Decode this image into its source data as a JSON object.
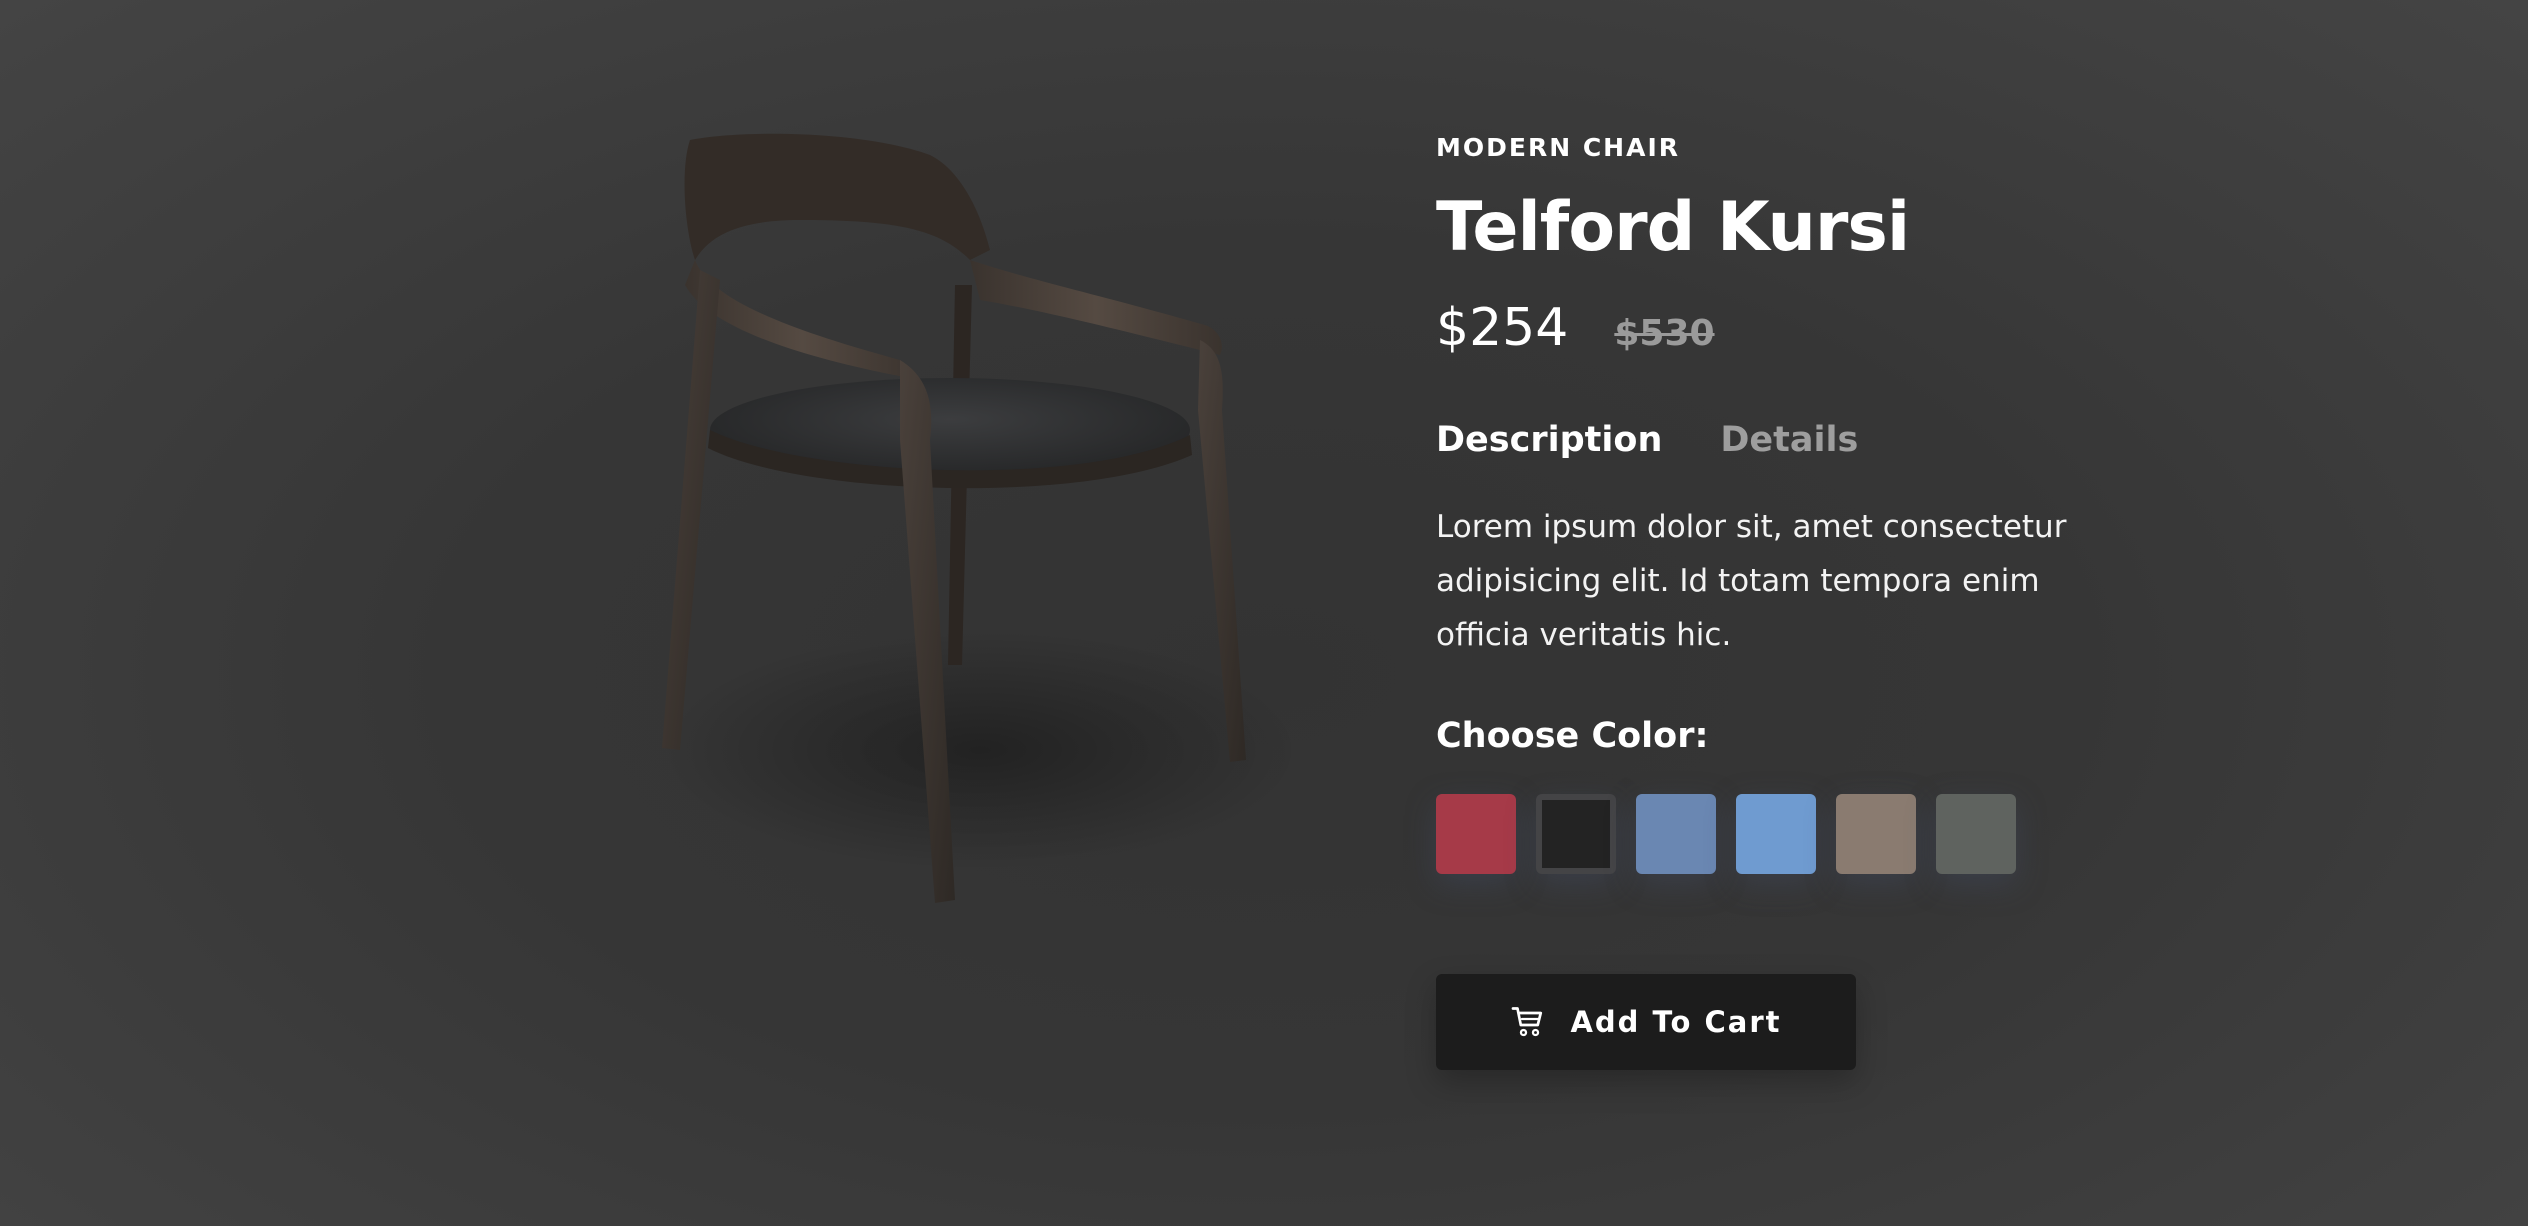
{
  "product": {
    "category": "MODERN CHAIR",
    "name": "Telford Kursi",
    "price": "$254",
    "old_price": "$530",
    "image_icon": "chair-image"
  },
  "tabs": [
    {
      "label": "Description",
      "active": true
    },
    {
      "label": "Details",
      "active": false
    }
  ],
  "description": "Lorem ipsum dolor sit, amet consectetur adipisicing elit. Id totam tempora enim officia veritatis hic.",
  "colors": {
    "heading": "Choose Color:",
    "options": [
      {
        "name": "red",
        "hex": "#a63a48"
      },
      {
        "name": "black",
        "hex": "#232323",
        "selected": true
      },
      {
        "name": "denim-blue",
        "hex": "#6a87b2"
      },
      {
        "name": "light-blue",
        "hex": "#6f9bd0"
      },
      {
        "name": "taupe",
        "hex": "#8a7b70"
      },
      {
        "name": "grey-green",
        "hex": "#5f635f"
      }
    ]
  },
  "cart": {
    "label": "Add To Cart",
    "icon": "cart-icon"
  }
}
